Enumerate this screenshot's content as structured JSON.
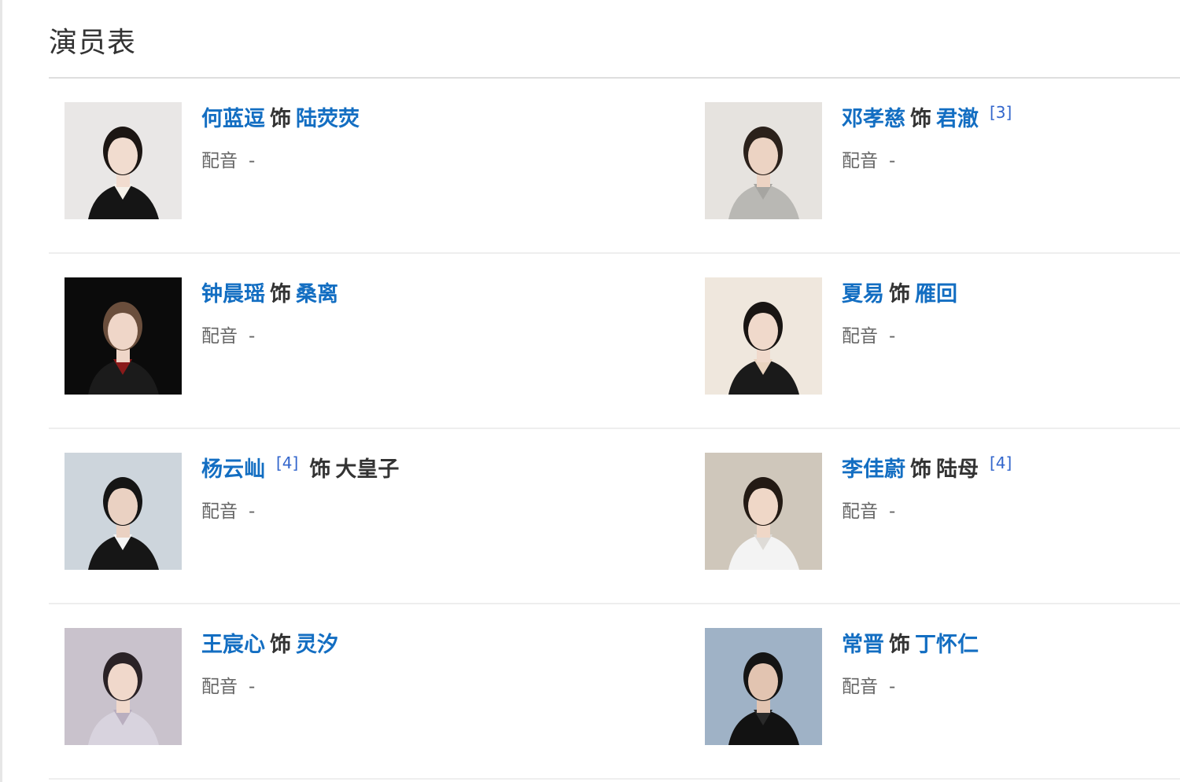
{
  "section": {
    "title": "演员表"
  },
  "colors": {
    "link": "#136ec2",
    "ref": "#3366cc",
    "text": "#333333",
    "muted": "#666666"
  },
  "as_word": "饰",
  "dub_label": "配音",
  "rows": [
    [
      {
        "actor": "何蓝逗",
        "role": "陆荧荧",
        "role_linked": true,
        "ref": null,
        "ref_after_actor": false,
        "dub": "-",
        "photo": {
          "bg": "#e9e7e6",
          "hair": "#1c1613",
          "skin": "#f1dccf",
          "cloth": "#151515",
          "accent": "#f5f1ea"
        }
      },
      {
        "actor": "邓孝慈",
        "role": "君澈",
        "role_linked": true,
        "ref": "[3]",
        "ref_after_actor": false,
        "dub": "-",
        "photo": {
          "bg": "#e6e3df",
          "hair": "#2b211b",
          "skin": "#ecd3c3",
          "cloth": "#b9b8b4",
          "accent": "#a6a5a1"
        }
      }
    ],
    [
      {
        "actor": "钟晨瑶",
        "role": "桑离",
        "role_linked": true,
        "ref": null,
        "ref_after_actor": false,
        "dub": "-",
        "photo": {
          "bg": "#0b0b0b",
          "hair": "#6a4e3c",
          "skin": "#efd6c8",
          "cloth": "#1b1b1b",
          "accent": "#8a1a1a"
        }
      },
      {
        "actor": "夏易",
        "role": "雁回",
        "role_linked": true,
        "ref": null,
        "ref_after_actor": false,
        "dub": "-",
        "photo": {
          "bg": "#efe7dd",
          "hair": "#191513",
          "skin": "#f0d9cb",
          "cloth": "#1a1a1a",
          "accent": "#e9d3bf"
        }
      }
    ],
    [
      {
        "actor": "杨云屾",
        "role": "大皇子",
        "role_linked": false,
        "ref": "[4]",
        "ref_after_actor": true,
        "dub": "-",
        "photo": {
          "bg": "#cdd5dc",
          "hair": "#151515",
          "skin": "#ead1c2",
          "cloth": "#161616",
          "accent": "#f4f4f4"
        }
      },
      {
        "actor": "李佳蔚",
        "role": "陆母",
        "role_linked": false,
        "ref": "[4]",
        "ref_after_actor": false,
        "dub": "-",
        "photo": {
          "bg": "#cfc7bb",
          "hair": "#231a14",
          "skin": "#efd7c7",
          "cloth": "#f3f3f3",
          "accent": "#dedbd7"
        }
      }
    ],
    [
      {
        "actor": "王宸心",
        "role": "灵汐",
        "role_linked": true,
        "ref": null,
        "ref_after_actor": false,
        "dub": "-",
        "photo": {
          "bg": "#c9c2cc",
          "hair": "#2a2226",
          "skin": "#f0d8cb",
          "cloth": "#d8d3de",
          "accent": "#b9aebf"
        }
      },
      {
        "actor": "常晋",
        "role": "丁怀仁",
        "role_linked": true,
        "ref": null,
        "ref_after_actor": false,
        "dub": "-",
        "photo": {
          "bg": "#9fb2c6",
          "hair": "#141414",
          "skin": "#e2c4b1",
          "cloth": "#121212",
          "accent": "#2a2a2a"
        }
      }
    ]
  ]
}
